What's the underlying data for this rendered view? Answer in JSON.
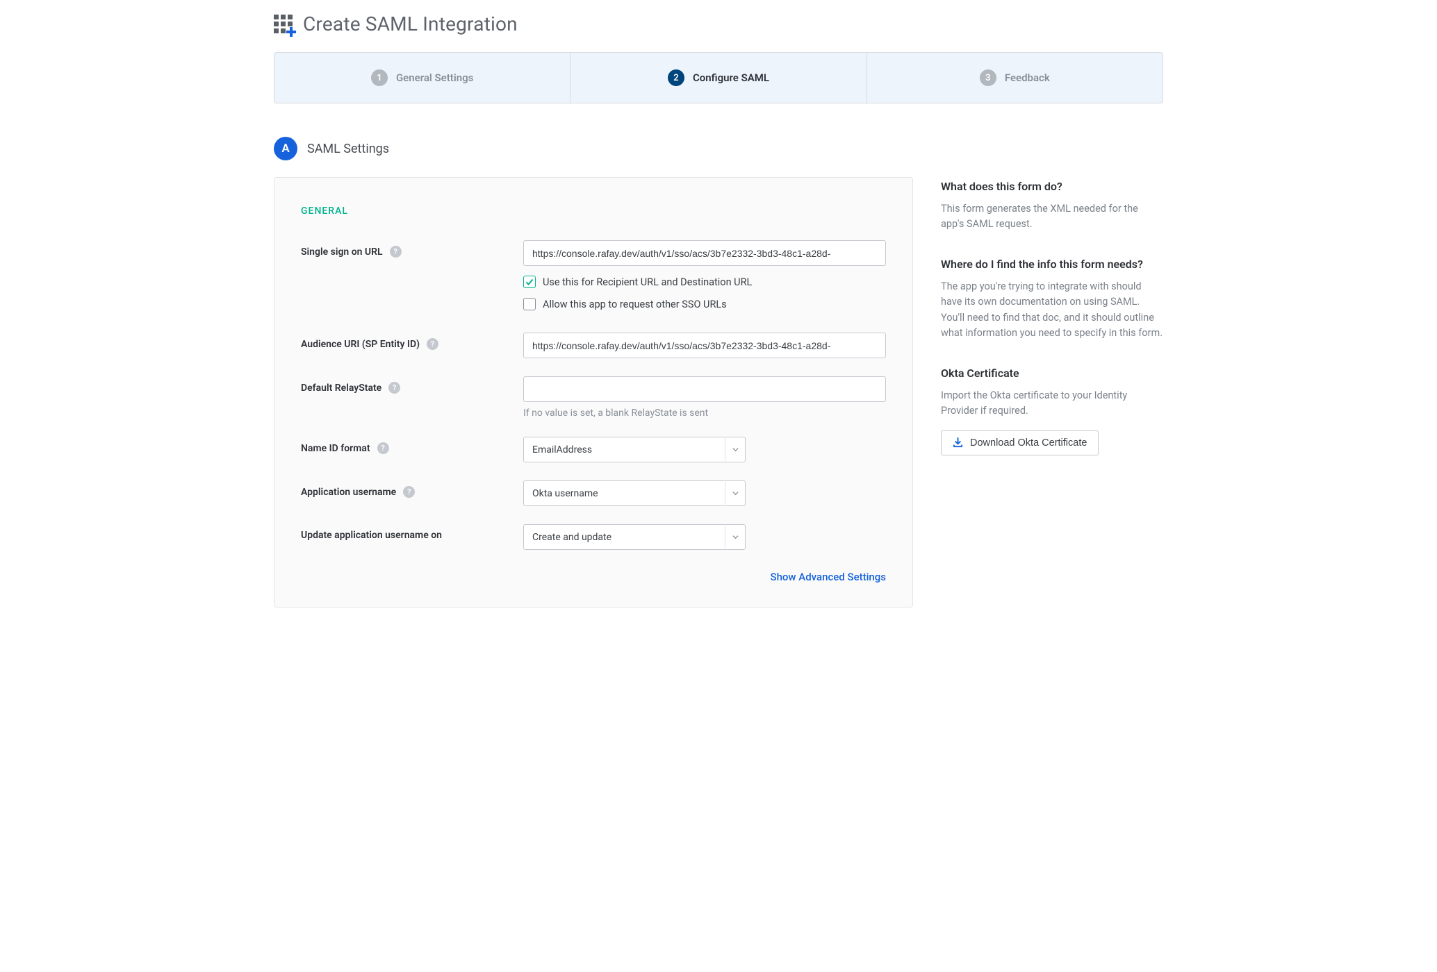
{
  "header": {
    "title": "Create SAML Integration"
  },
  "wizard": {
    "steps": [
      {
        "num": "1",
        "label": "General Settings",
        "active": false
      },
      {
        "num": "2",
        "label": "Configure SAML",
        "active": true
      },
      {
        "num": "3",
        "label": "Feedback",
        "active": false
      }
    ]
  },
  "section": {
    "badge": "A",
    "title": "SAML Settings"
  },
  "form": {
    "general_heading": "GENERAL",
    "sso_url": {
      "label": "Single sign on URL",
      "value": "https://console.rafay.dev/auth/v1/sso/acs/3b7e2332-3bd3-48c1-a28d-",
      "use_for_recipient_label": "Use this for Recipient URL and Destination URL",
      "use_for_recipient_checked": true,
      "allow_other_label": "Allow this app to request other SSO URLs",
      "allow_other_checked": false
    },
    "audience_uri": {
      "label": "Audience URI (SP Entity ID)",
      "value": "https://console.rafay.dev/auth/v1/sso/acs/3b7e2332-3bd3-48c1-a28d-"
    },
    "relay_state": {
      "label": "Default RelayState",
      "value": "",
      "hint": "If no value is set, a blank RelayState is sent"
    },
    "name_id_format": {
      "label": "Name ID format",
      "value": "EmailAddress"
    },
    "app_username": {
      "label": "Application username",
      "value": "Okta username"
    },
    "update_username_on": {
      "label": "Update application username on",
      "value": "Create and update"
    },
    "advanced_link": "Show Advanced Settings"
  },
  "sidebar": {
    "q1": {
      "heading": "What does this form do?",
      "text": "This form generates the XML needed for the app's SAML request."
    },
    "q2": {
      "heading": "Where do I find the info this form needs?",
      "text": "The app you're trying to integrate with should have its own documentation on using SAML. You'll need to find that doc, and it should outline what information you need to specify in this form."
    },
    "cert": {
      "heading": "Okta Certificate",
      "text": "Import the Okta certificate to your Identity Provider if required.",
      "button": "Download Okta Certificate"
    }
  }
}
